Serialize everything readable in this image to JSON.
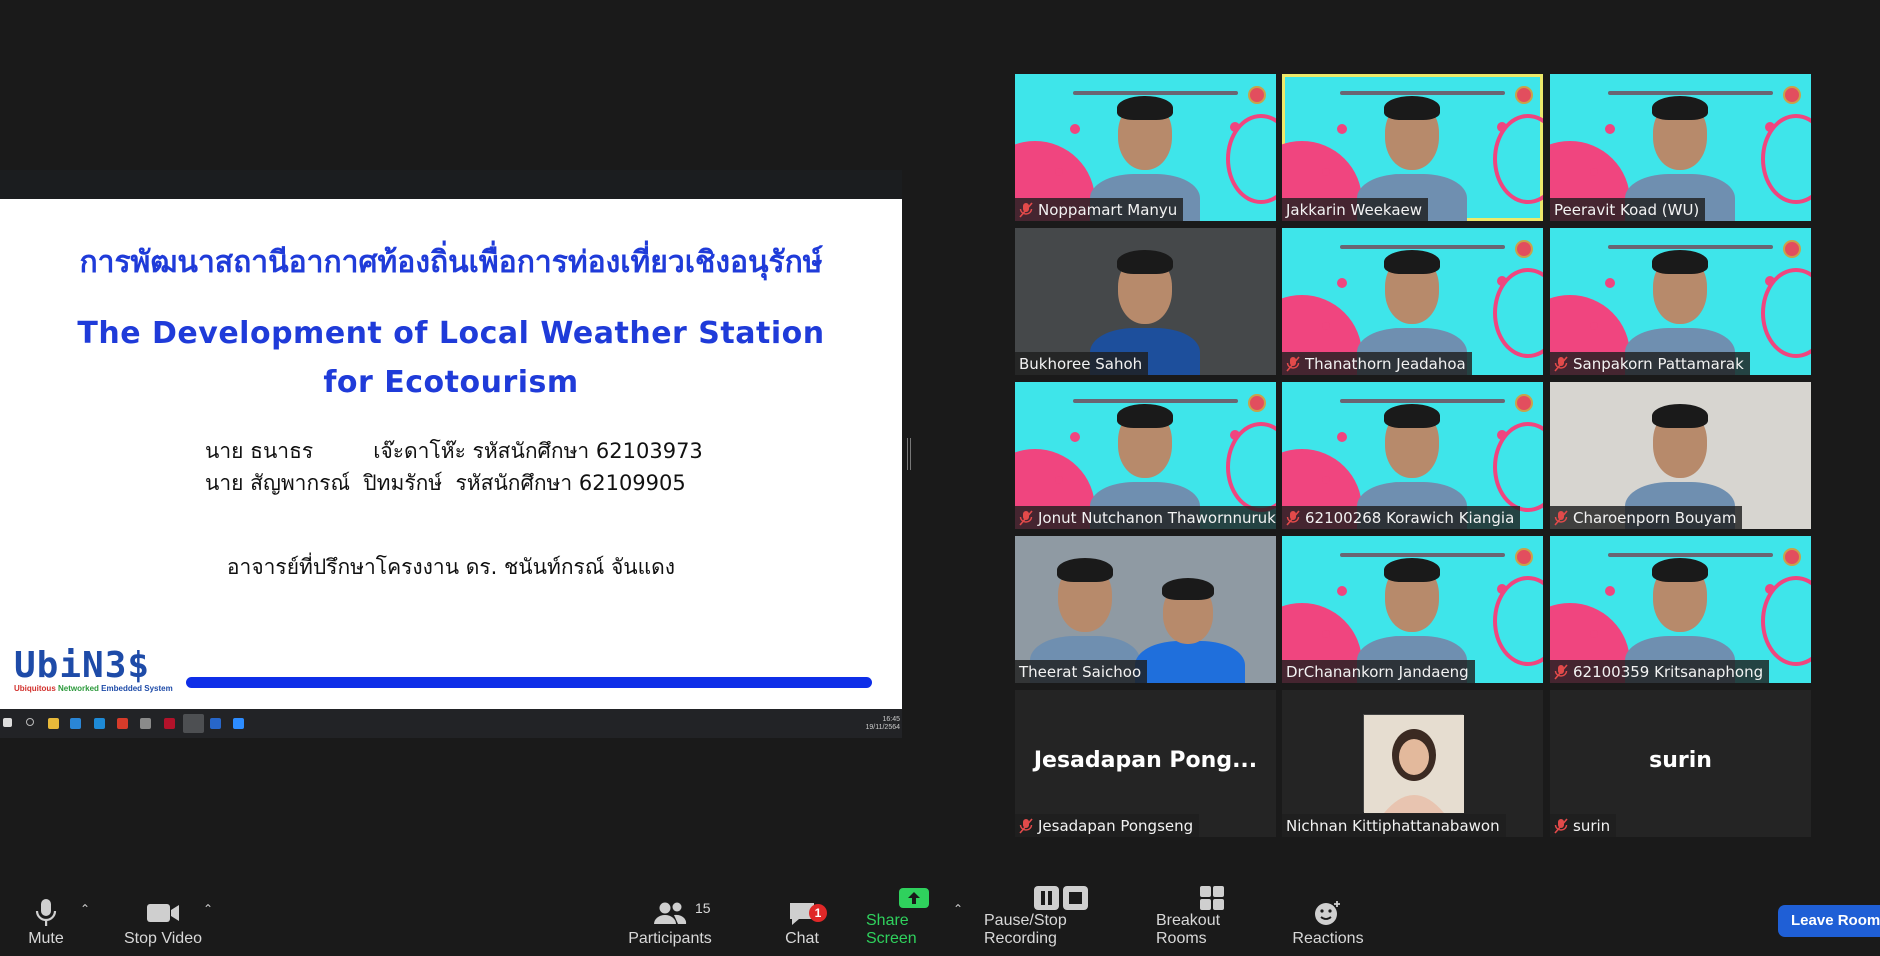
{
  "slide": {
    "title_th": "การพัฒนาสถานีอากาศท้องถิ่นเพื่อการท่องเที่ยวเชิงอนุรักษ์",
    "title_en": "The Development of Local Weather Station for Ecotourism",
    "student_1": "นาย ธนาธร         เจ๊ะดาโห๊ะ รหัสนักศึกษา 62103973",
    "student_2": "นาย สัญพากรณ์  ปิทมรักษ์  รหัสนักศึกษา 62109905",
    "advisor": "อาจารย์ที่ปรึกษาโครงงาน ดร. ชนันท์กรณ์ จันแดง",
    "logo": "UbiN3$",
    "logo_sub_1": "Ubiquitous",
    "logo_sub_2": "Networked",
    "logo_sub_3": "Embedded System"
  },
  "taskbar": {
    "time": "16:45",
    "date": "19/11/2564"
  },
  "participants": [
    {
      "name": "Noppamart Manyu",
      "muted": true,
      "bg": "event",
      "active": false
    },
    {
      "name": "Jakkarin Weekaew",
      "muted": false,
      "bg": "event",
      "active": true
    },
    {
      "name": "Peeravit Koad (WU)",
      "muted": false,
      "bg": "event",
      "active": false
    },
    {
      "name": "Bukhoree Sahoh",
      "muted": false,
      "bg": "dark",
      "active": false
    },
    {
      "name": "Thanathorn Jeadahoa",
      "muted": true,
      "bg": "event",
      "active": false
    },
    {
      "name": "Sanpakorn Pattamarak",
      "muted": true,
      "bg": "event",
      "active": false
    },
    {
      "name": "Jonut Nutchanon Thawornnuruk",
      "muted": true,
      "bg": "event",
      "active": false
    },
    {
      "name": "62100268 Korawich Kiangia",
      "muted": true,
      "bg": "event",
      "active": false
    },
    {
      "name": "Charoenporn Bouyam",
      "muted": true,
      "bg": "wall",
      "active": false
    },
    {
      "name": "Theerat Saichoo",
      "muted": false,
      "bg": "office",
      "active": false
    },
    {
      "name": "DrChanankorn Jandaeng",
      "muted": false,
      "bg": "event",
      "active": false
    },
    {
      "name": "62100359 Kritsanaphong",
      "muted": true,
      "bg": "event",
      "active": false
    },
    {
      "name": "Jesadapan Pongseng",
      "muted": true,
      "bg": "none",
      "display_name": "Jesadapan  Pong...",
      "active": false
    },
    {
      "name": "Nichnan Kittiphattanabawon",
      "muted": false,
      "bg": "photo",
      "active": false
    },
    {
      "name": "surin",
      "muted": true,
      "bg": "none",
      "display_name": "surin",
      "active": false
    }
  ],
  "toolbar": {
    "mute": "Mute",
    "stop_video": "Stop Video",
    "participants": "Participants",
    "participants_count": "15",
    "chat": "Chat",
    "chat_badge": "1",
    "share_screen": "Share Screen",
    "pause_recording": "Pause/Stop Recording",
    "breakout": "Breakout Rooms",
    "reactions": "Reactions",
    "leave": "Leave Room"
  },
  "colors": {
    "accent_blue": "#1f3bd9",
    "active_speaker": "#ede96a",
    "share_green": "#2fd15d",
    "leave_blue": "#1f5fd6"
  }
}
